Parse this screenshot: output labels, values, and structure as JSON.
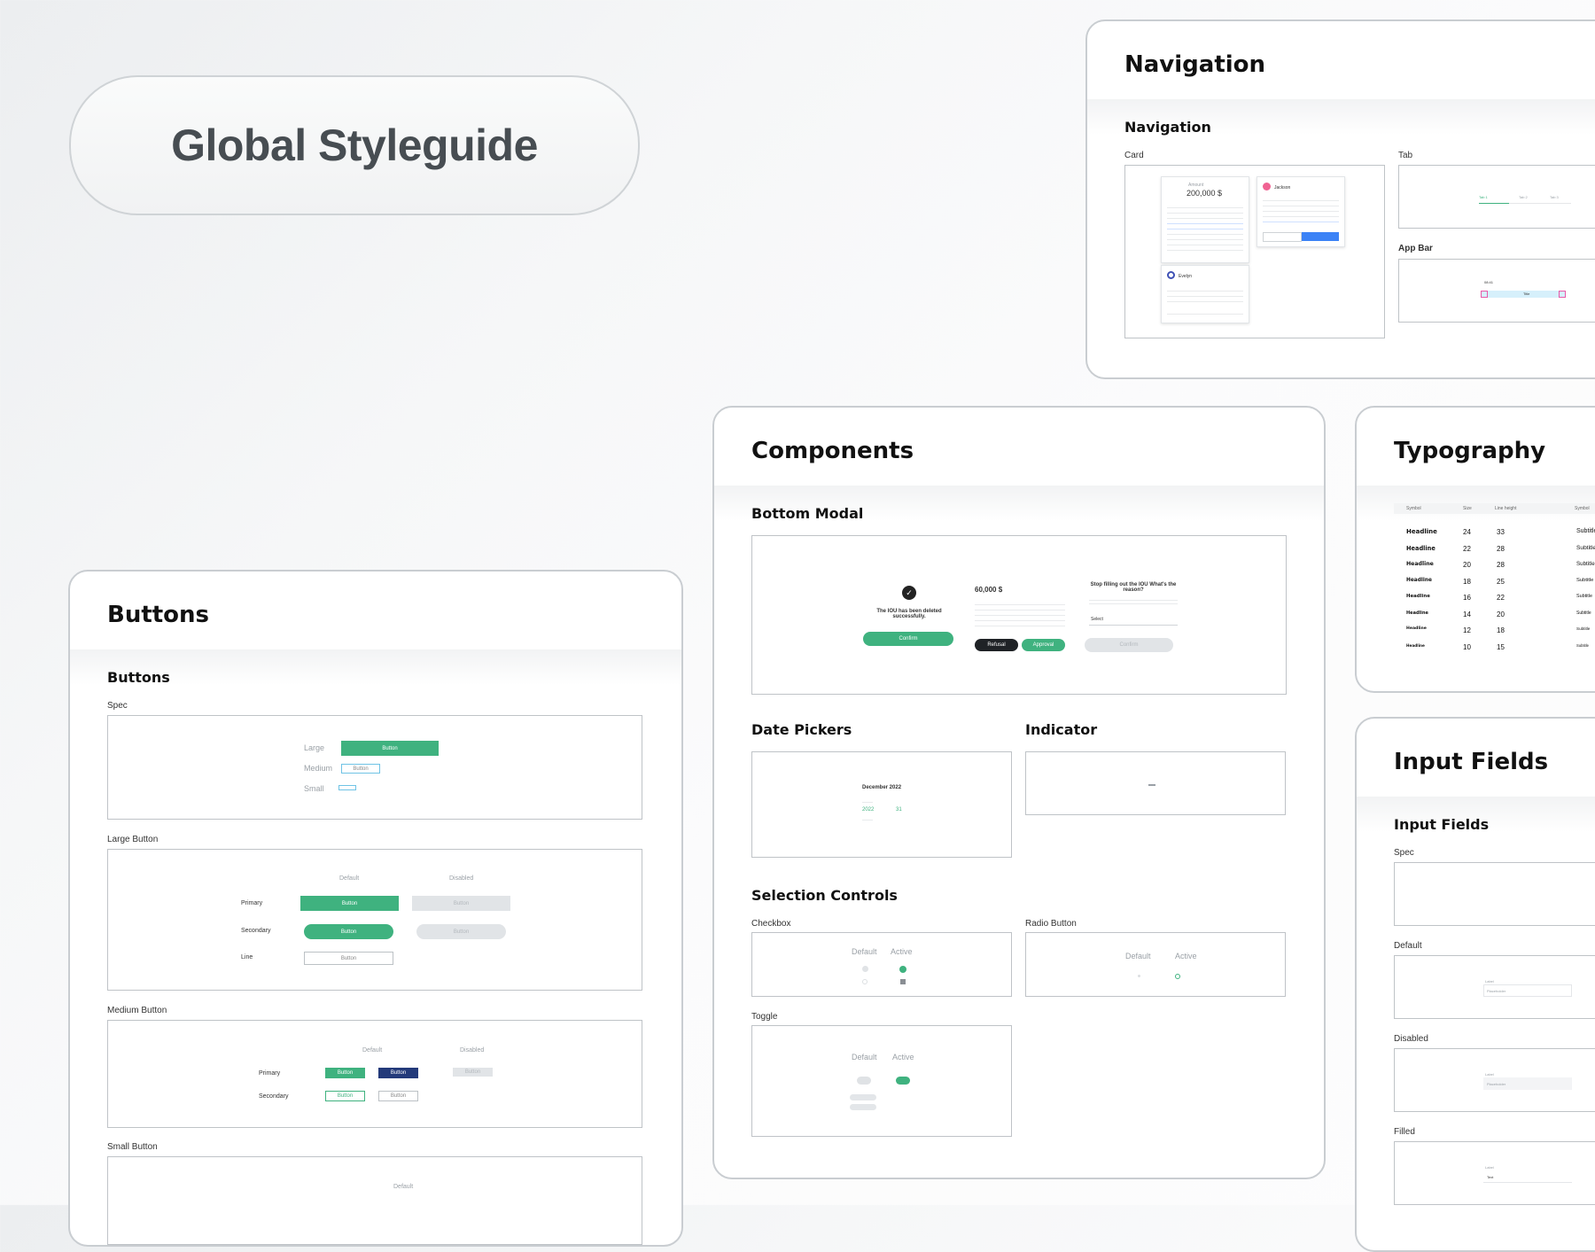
{
  "hero": {
    "title": "Global Styleguide"
  },
  "navigation_board": {
    "header": "Navigation",
    "section": "Navigation",
    "card_label": "Card",
    "tab_label": "Tab",
    "appbar_label": "App Bar",
    "card1": {
      "amount": "200,000 $"
    },
    "card2": {
      "name": "Jackson"
    },
    "card3": {
      "name": "Evelyn"
    },
    "appbar": {
      "time": "08:41",
      "title": "Title"
    },
    "tabs": [
      "Tab 1",
      "Tab 2",
      "Tab 3"
    ]
  },
  "components_board": {
    "header": "Components",
    "bottom_modal": {
      "title": "Bottom Modal",
      "success_text": "The IOU has been deleted successfully.",
      "confirm": "Confirm",
      "amount": "60,000 $",
      "refusal": "Refusal",
      "approval": "Approval",
      "question": "Stop filling out the IOU What's the reason?",
      "select": "Select",
      "confirm_disabled": "Confirm"
    },
    "date_pickers": {
      "title": "Date Pickers",
      "month": "December 2022",
      "year": "2022",
      "day": "31"
    },
    "indicator": {
      "title": "Indicator"
    },
    "selection_controls": {
      "title": "Selection Controls",
      "checkbox": "Checkbox",
      "radio": "Radio Button",
      "toggle": "Toggle",
      "default": "Default",
      "active": "Active"
    }
  },
  "buttons_board": {
    "header": "Buttons",
    "section": "Buttons",
    "spec": "Spec",
    "sizes": [
      "Large",
      "Medium",
      "Small"
    ],
    "button_text": "Button",
    "large_button": "Large Button",
    "medium_button": "Medium Button",
    "small_button": "Small Button",
    "default": "Default",
    "disabled": "Disabled",
    "primary": "Primary",
    "secondary": "Secondary",
    "line": "Line"
  },
  "typography_board": {
    "header": "Typography",
    "columns": [
      "Symbol",
      "Size",
      "Line height",
      "Symbol"
    ],
    "rows": [
      {
        "name": "Headline",
        "size": "24",
        "lh": "33",
        "sub": "Subtitle"
      },
      {
        "name": "Headline",
        "size": "22",
        "lh": "28",
        "sub": "Subtitle"
      },
      {
        "name": "Headline",
        "size": "20",
        "lh": "28",
        "sub": "Subtitle"
      },
      {
        "name": "Headline",
        "size": "18",
        "lh": "25",
        "sub": "Subtitle"
      },
      {
        "name": "Headline",
        "size": "16",
        "lh": "22",
        "sub": "Subtitle"
      },
      {
        "name": "Headline",
        "size": "14",
        "lh": "20",
        "sub": "Subtitle"
      },
      {
        "name": "Headline",
        "size": "12",
        "lh": "18",
        "sub": "Subtitle"
      },
      {
        "name": "Headline",
        "size": "10",
        "lh": "15",
        "sub": "Subtitle"
      }
    ]
  },
  "input_board": {
    "header": "Input Fields",
    "section": "Input Fields",
    "spec": "Spec",
    "default": "Default",
    "disabled": "Disabled",
    "filled": "Filled",
    "placeholder": "Placeholder",
    "field_label": "Label",
    "filled_value": "Text"
  },
  "colors": {
    "accent": "#3fb27f",
    "navy": "#233a7a",
    "blue": "#3b82f6",
    "dark": "#1f2226"
  }
}
